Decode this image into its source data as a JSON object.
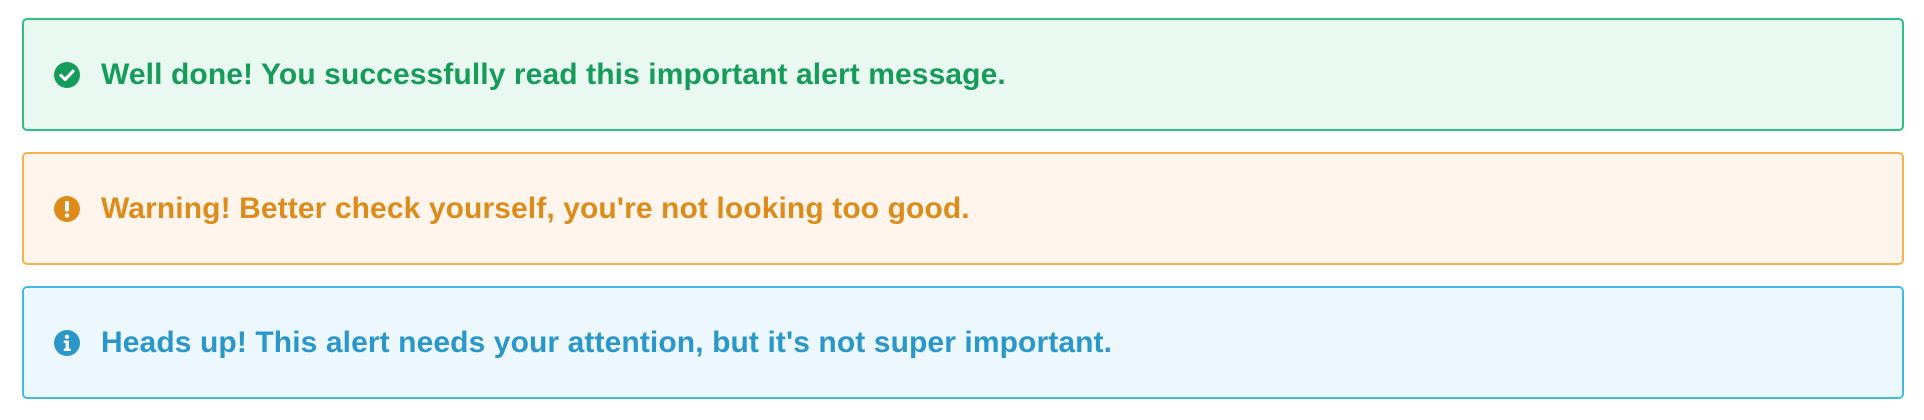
{
  "alerts": [
    {
      "type": "success",
      "icon": "check-circle-icon",
      "text": "Well done! You successfully read this important alert message.",
      "colors": {
        "background": "#e9f8f1",
        "border": "#2dc084",
        "text": "#169c5a"
      }
    },
    {
      "type": "warning",
      "icon": "exclamation-circle-icon",
      "text": "Warning! Better check yourself, you're not looking too good.",
      "colors": {
        "background": "#fff5ec",
        "border": "#f6b24d",
        "text": "#dd8c1c"
      }
    },
    {
      "type": "info",
      "icon": "info-circle-icon",
      "text": "Heads up! This alert needs your attention, but it's not super important.",
      "colors": {
        "background": "#ecf8fd",
        "border": "#42bbe4",
        "text": "#2a97c8"
      }
    }
  ]
}
